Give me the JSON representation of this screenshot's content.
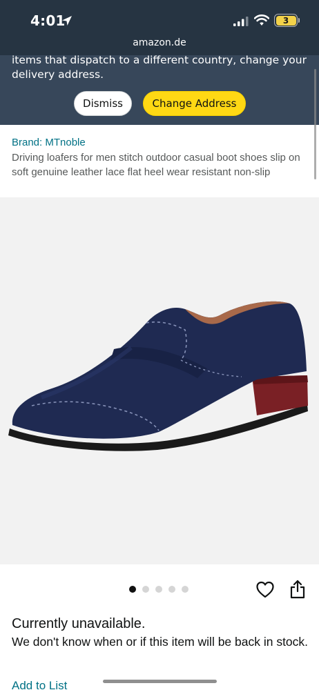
{
  "status_bar": {
    "time": "4:01",
    "battery_level": "3"
  },
  "browser": {
    "url": "amazon.de"
  },
  "banner": {
    "message": "items that dispatch to a different country, change your delivery address.",
    "dismiss_label": "Dismiss",
    "change_address_label": "Change Address"
  },
  "product": {
    "brand": "Brand: MTnoble",
    "title": "Driving loafers for men stitch outdoor casual boot shoes slip on soft genuine leather lace flat heel wear resistant non-slip",
    "carousel_dot_count": 5,
    "active_dot_index": 0
  },
  "availability": {
    "status": "Currently unavailable.",
    "note": "We don't know when or if this item will be back in stock."
  },
  "actions": {
    "add_to_list": "Add to List"
  },
  "icons": {
    "heart": "heart-icon",
    "share": "share-icon",
    "signal": "cellular-signal-icon",
    "wifi": "wifi-icon",
    "location": "location-arrow-icon"
  },
  "colors": {
    "banner_bg": "#37475a",
    "top_chrome_bg": "#263442",
    "change_address_button": "#ffd814",
    "link": "#007185",
    "shoe": "#1f2a52",
    "sole_accent": "#7a2025"
  }
}
